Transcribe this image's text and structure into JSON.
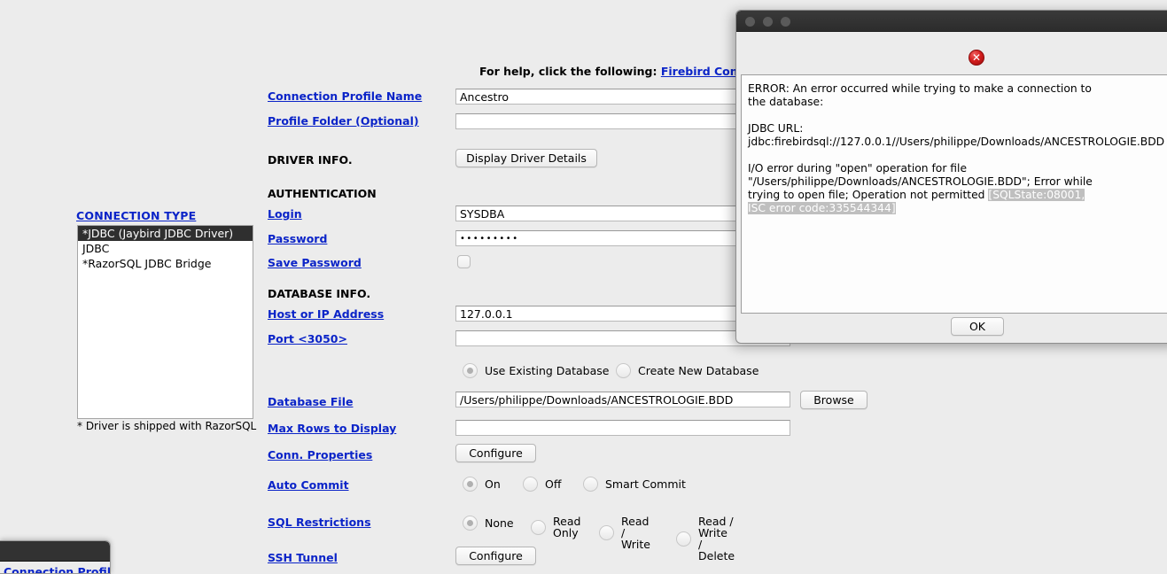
{
  "main_window": {
    "help": {
      "prefix": "For help, click the following:",
      "link_label": "Firebird Connection"
    },
    "connection_type": {
      "title": "CONNECTION TYPE",
      "items": [
        {
          "label": "*JDBC (Jaybird JDBC Driver)",
          "selected": true
        },
        {
          "label": "JDBC",
          "selected": false
        },
        {
          "label": "*RazorSQL JDBC Bridge",
          "selected": false
        }
      ],
      "footnote": "* Driver is shipped with RazorSQL"
    },
    "labels": {
      "connection_profile_name": "Connection Profile Name",
      "profile_folder": "Profile Folder (Optional)",
      "driver_info": "DRIVER INFO.",
      "authentication": "AUTHENTICATION",
      "login": "Login",
      "password": "Password",
      "save_password": "Save Password",
      "database_info": "DATABASE INFO.",
      "host_or_ip": "Host or IP Address",
      "port": "Port <3050>",
      "database_file": "Database File",
      "max_rows": "Max Rows to Display",
      "conn_properties": "Conn. Properties",
      "auto_commit": "Auto Commit",
      "sql_restrictions": "SQL Restrictions",
      "ssh_tunnel": "SSH Tunnel"
    },
    "values": {
      "connection_profile_name": "Ancestro",
      "profile_folder": "",
      "login": "SYSDBA",
      "password_masked": "•••••••••",
      "host_or_ip": "127.0.0.1",
      "port": "",
      "database_file": "/Users/philippe/Downloads/ANCESTROLOGIE.BDD",
      "max_rows": ""
    },
    "buttons": {
      "display_driver_details": "Display Driver Details",
      "browse": "Browse",
      "conn_properties_configure": "Configure",
      "ssh_tunnel_configure": "Configure"
    },
    "checkboxes": {
      "save_password_checked": false
    },
    "database_mode": {
      "options": [
        {
          "label": "Use Existing Database",
          "selected": true
        },
        {
          "label": "Create New Database",
          "selected": false
        }
      ]
    },
    "auto_commit": {
      "options": [
        {
          "label": "On",
          "selected": true
        },
        {
          "label": "Off",
          "selected": false
        },
        {
          "label": "Smart Commit",
          "selected": false
        }
      ]
    },
    "sql_restrictions": {
      "options": [
        {
          "label": "None",
          "selected": true
        },
        {
          "label": "Read\nOnly",
          "selected": false
        },
        {
          "label": "Read /\nWrite",
          "selected": false
        },
        {
          "label": "Read / Write\n/ Delete",
          "selected": false
        }
      ]
    }
  },
  "background_window": {
    "partial_label": "Connection Profile"
  },
  "error_dialog": {
    "icon": "error-circle-x-icon",
    "message_part1": "ERROR: An error occurred while trying to make a connection to\nthe database:\n\nJDBC URL:\njdbc:firebirdsql://127.0.0.1//Users/philippe/Downloads/ANCESTROLOGIE.BDD\n\nI/O error during \"open\" operation for file\n\"/Users/philippe/Downloads/ANCESTROLOGIE.BDD\"; Error while\ntrying to open file; Operation not permitted ",
    "message_selected": "[SQLState:08001,\nISC error code:335544344]",
    "ok_label": "OK"
  },
  "colors": {
    "window_background": "#ececec",
    "link_blue": "#0b24c8",
    "list_selection": "#2f2f2f",
    "text_selection": "#bfbfbf",
    "error_red": "#d51f1f",
    "titlebar_dark": "#323232"
  }
}
